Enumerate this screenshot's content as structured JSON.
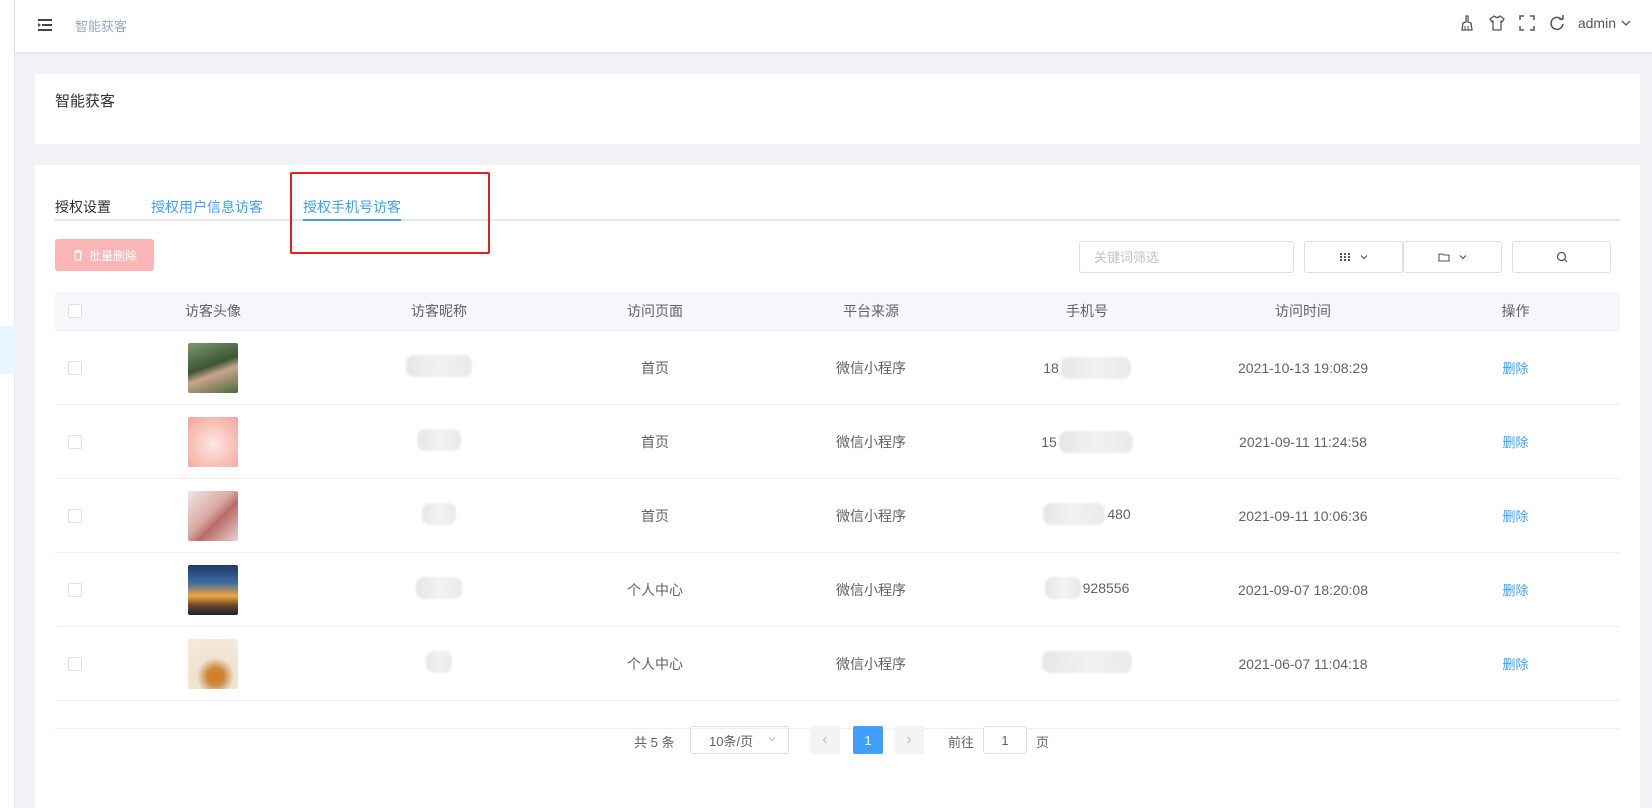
{
  "header": {
    "breadcrumb": "智能获客",
    "user": "admin",
    "icons": [
      "clean-icon",
      "tshirt-icon",
      "fullscreen-icon",
      "refresh-icon"
    ]
  },
  "page": {
    "title": "智能获客"
  },
  "tabs": [
    {
      "label": "授权设置",
      "active": false
    },
    {
      "label": "授权用户信息访客",
      "active": false
    },
    {
      "label": "授权手机号访客",
      "active": true
    }
  ],
  "toolbar": {
    "batch_delete": "批量删除",
    "search_placeholder": "关键词筛选"
  },
  "table": {
    "headers": [
      "访客头像",
      "访客昵称",
      "访问页面",
      "平台来源",
      "手机号",
      "访问时间",
      "操作"
    ],
    "rows": [
      {
        "page": "首页",
        "platform": "微信小程序",
        "phone_visible": "18",
        "time": "2021-10-13 19:08:29",
        "action": "删除",
        "avatar_color": "#5a7a4e"
      },
      {
        "page": "首页",
        "platform": "微信小程序",
        "phone_visible": "15",
        "time": "2021-09-11 11:24:58",
        "action": "删除",
        "avatar_color": "#f7b6b0"
      },
      {
        "page": "首页",
        "platform": "微信小程序",
        "phone_visible": "480",
        "time": "2021-09-11 10:06:36",
        "action": "删除",
        "avatar_color": "#d9a8a3"
      },
      {
        "page": "个人中心",
        "platform": "微信小程序",
        "phone_visible": "928556",
        "time": "2021-09-07 18:20:08",
        "action": "删除",
        "avatar_color": "#2b4a7a"
      },
      {
        "page": "个人中心",
        "platform": "微信小程序",
        "phone_visible": "",
        "time": "2021-06-07 11:04:18",
        "action": "删除",
        "avatar_color": "#efe2cf"
      }
    ]
  },
  "pagination": {
    "total": "共 5 条",
    "page_size": "10条/页",
    "current": "1",
    "goto_label": "前往",
    "goto_value": "1",
    "page_suffix": "页"
  }
}
